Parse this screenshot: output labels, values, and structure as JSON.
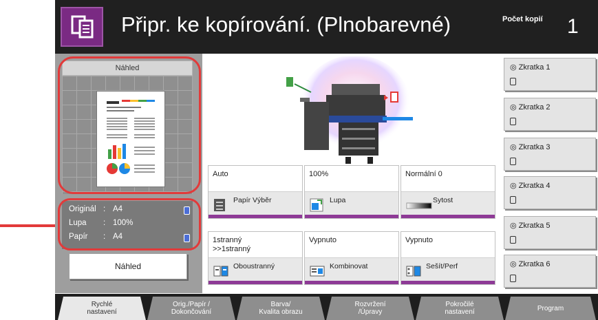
{
  "header": {
    "title": "Připr. ke kopírování. (Plnobarevné)",
    "copies_label": "Počet kopií",
    "copies_value": "1"
  },
  "preview": {
    "title": "Náhled",
    "button_label": "Náhled",
    "info": [
      {
        "key": "Originál",
        "value": "A4"
      },
      {
        "key": "Lupa",
        "value": "100%"
      },
      {
        "key": "Papír",
        "value": "A4"
      }
    ]
  },
  "functions": [
    {
      "value": "Auto",
      "label": "Papír Výběr",
      "icon": "paper-tray-icon"
    },
    {
      "value": "100%",
      "label": "Lupa",
      "icon": "zoom-icon"
    },
    {
      "value": "Normální 0",
      "label": "Sytost",
      "icon": "density-icon"
    },
    {
      "value": "1stranný >>1stranný",
      "label": "Oboustranný",
      "icon": "duplex-icon"
    },
    {
      "value": "Vypnuto",
      "label": "Kombinovat",
      "icon": "combine-icon"
    },
    {
      "value": "Vypnuto",
      "label": "Sešít/Perf",
      "icon": "staple-punch-icon"
    }
  ],
  "shortcuts": [
    "Zkratka 1",
    "Zkratka 2",
    "Zkratka 3",
    "Zkratka 4",
    "Zkratka 5",
    "Zkratka 6"
  ],
  "tabs": [
    {
      "line1": "Rychlé",
      "line2": "nastavení"
    },
    {
      "line1": "Orig./Papír /",
      "line2": "Dokončování"
    },
    {
      "line1": "Barva/",
      "line2": "Kvalita obrazu"
    },
    {
      "line1": "Rozvržení",
      "line2": "/Úpravy"
    },
    {
      "line1": "Pokročilé",
      "line2": "nastavení"
    },
    {
      "line1": "Program",
      "line2": ""
    }
  ],
  "colors": {
    "accent": "#8e3a96",
    "header_bg": "#202020",
    "highlight": "#e23a3a"
  }
}
